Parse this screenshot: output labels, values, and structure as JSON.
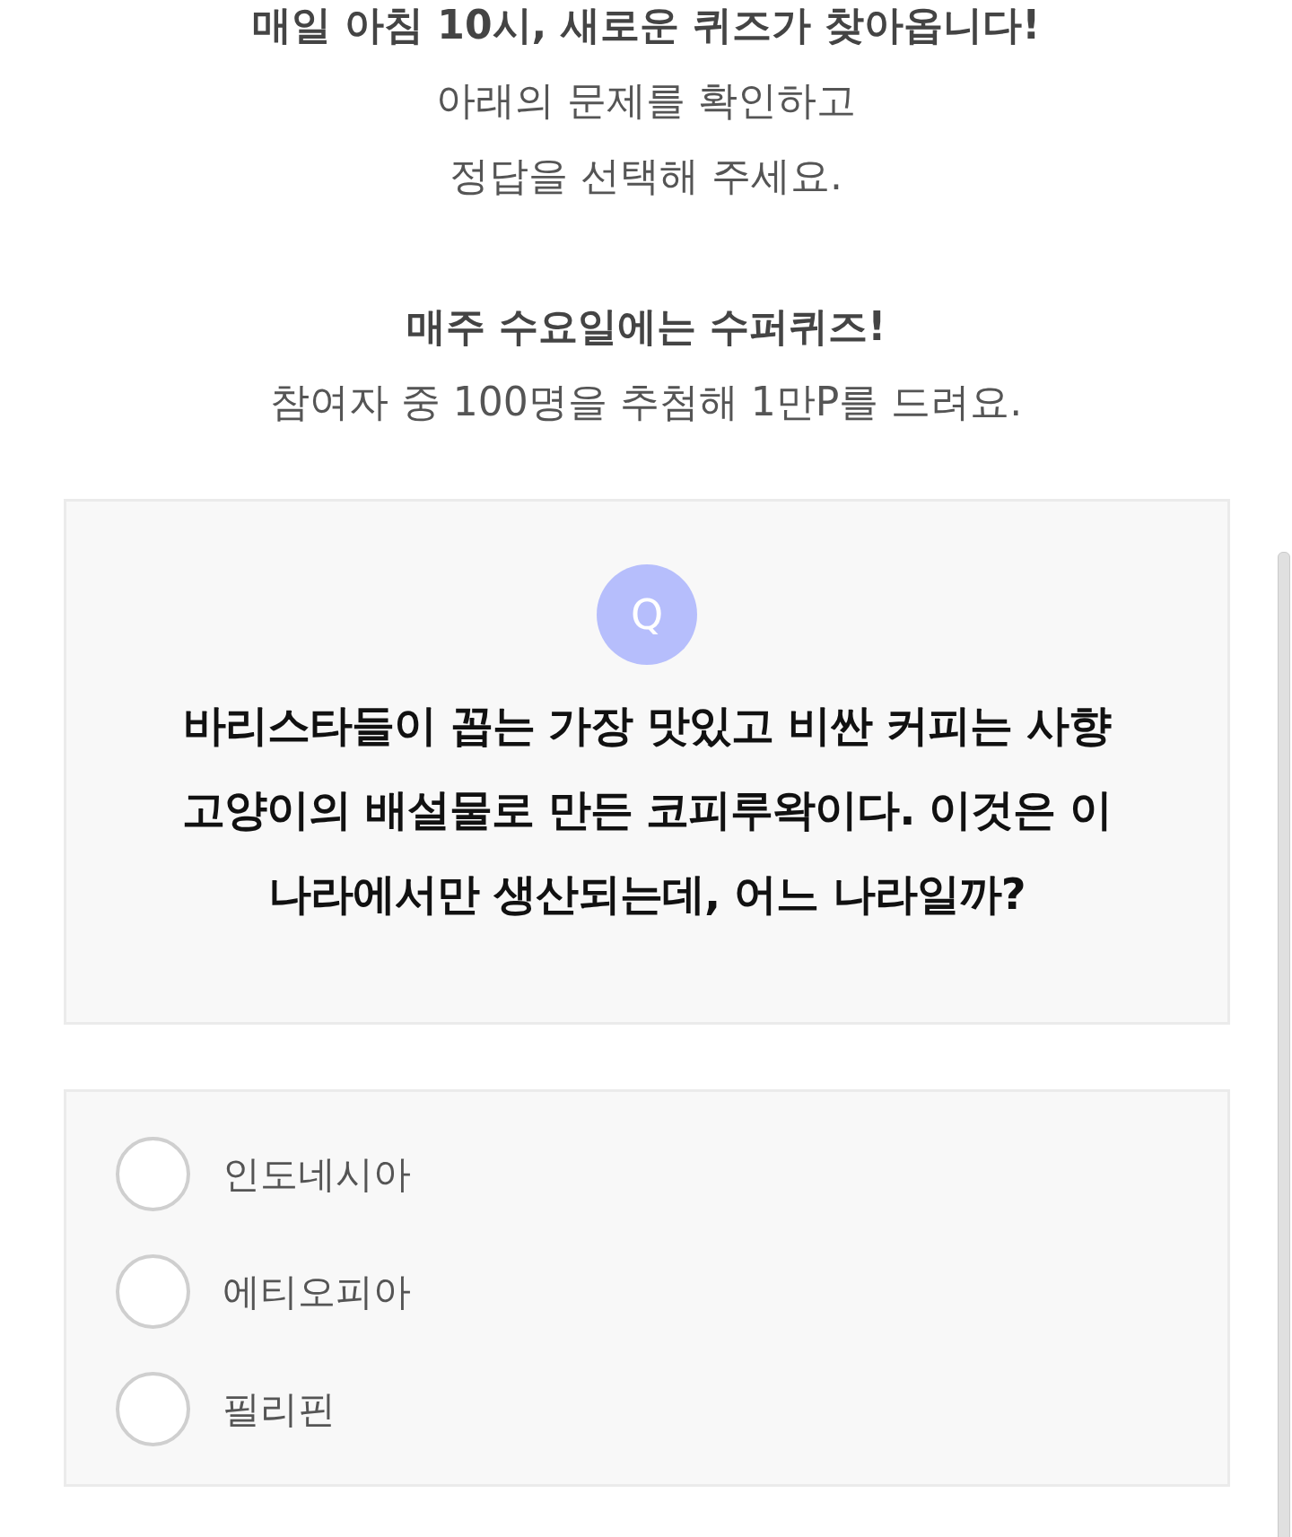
{
  "intro": [
    {
      "kind": "headline",
      "text": "매일 아침 10시, 새로운 퀴즈가 찾아옵니다!"
    },
    {
      "kind": "body",
      "text": "아래의 문제를 확인하고"
    },
    {
      "kind": "body",
      "text": "정답을 선택해 주세요."
    },
    {
      "kind": "gap"
    },
    {
      "kind": "headline",
      "text": "매주 수요일에는 수퍼퀴즈!"
    },
    {
      "kind": "body",
      "text": "참여자 중 100명을 추첨해 1만P를 드려요."
    }
  ],
  "question": {
    "badge": "Q",
    "text": "바리스타들이 꼽는 가장 맛있고 비싼 커피는 사향 고양이의 배설물로 만든 코피루왁이다. 이것은 이 나라에서만 생산되는데, 어느 나라일까?"
  },
  "options": [
    {
      "label": "인도네시아",
      "selected": false
    },
    {
      "label": "에티오피아",
      "selected": false
    },
    {
      "label": "필리핀",
      "selected": false
    }
  ]
}
